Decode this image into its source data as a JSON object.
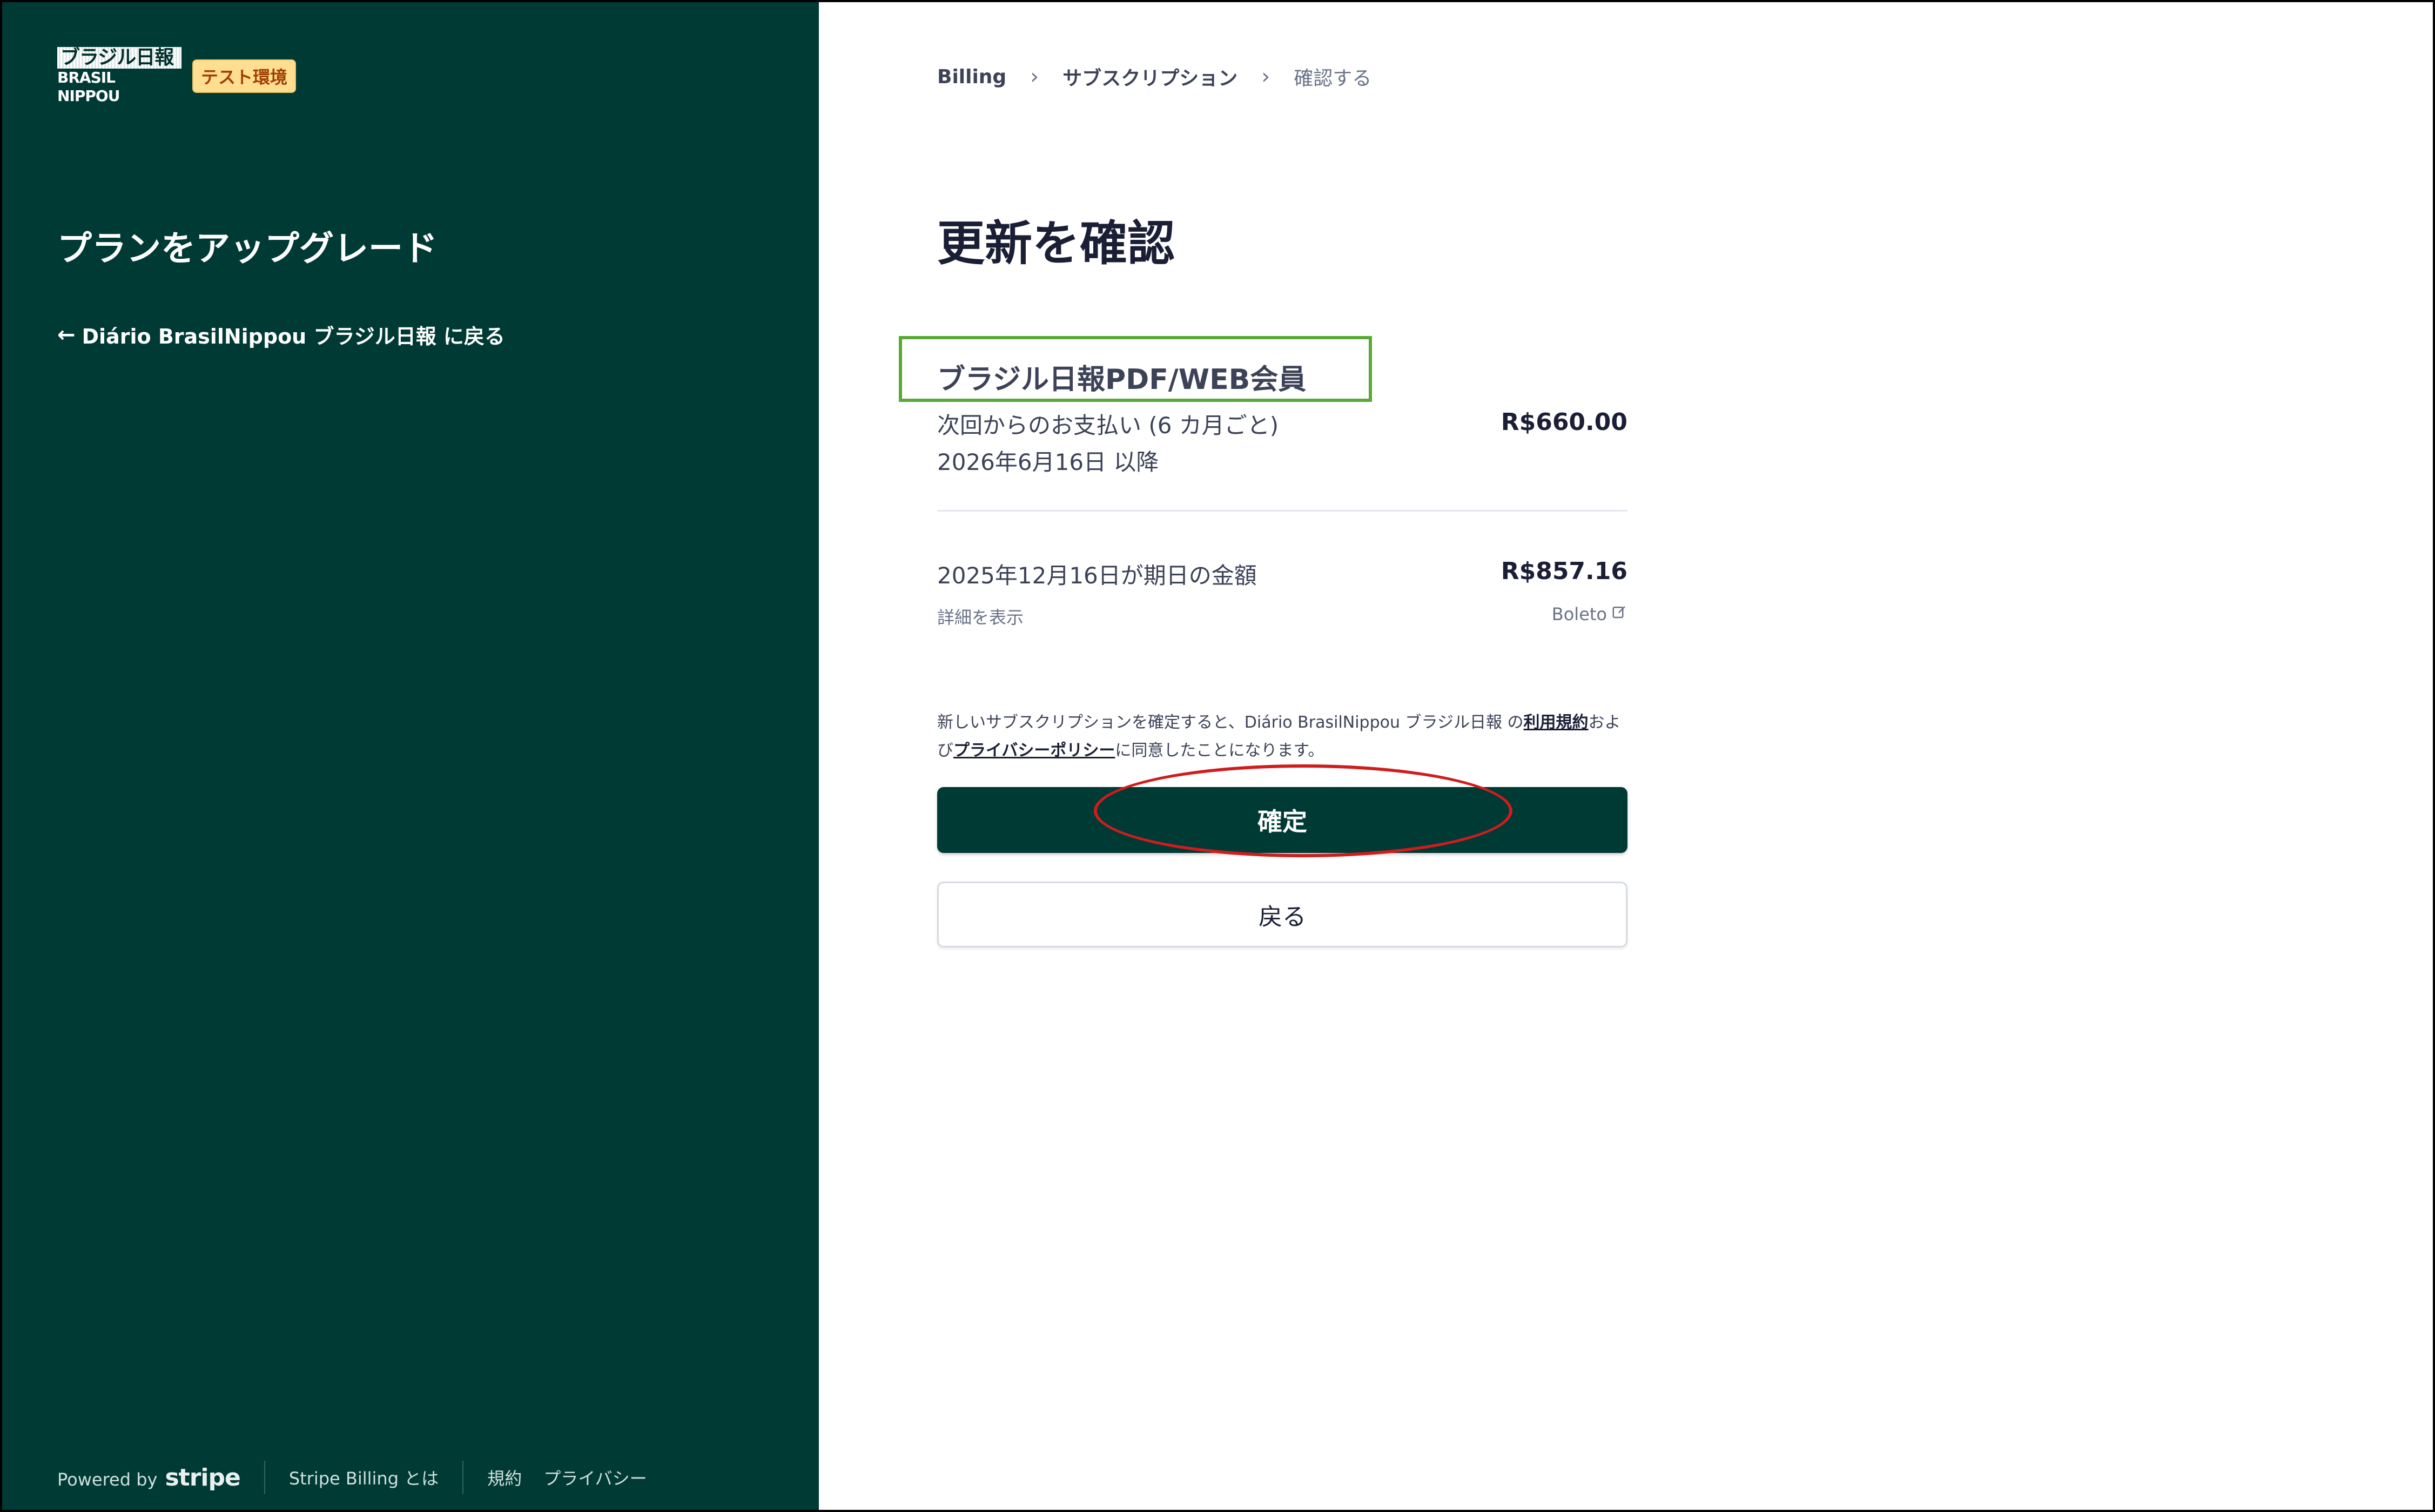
{
  "brand": {
    "logo_jp": "ブラジル日報",
    "logo_en": "BRASIL NIPPOU",
    "env_badge": "テスト環境"
  },
  "sidebar": {
    "title": "プランをアップグレード",
    "back_link": "Diário BrasilNippou ブラジル日報 に戻る"
  },
  "footer": {
    "powered_by": "Powered by",
    "stripe": "stripe",
    "stripe_billing": "Stripe Billing とは",
    "terms": "規約",
    "privacy": "プライバシー"
  },
  "breadcrumb": {
    "items": [
      "Billing",
      "サブスクリプション",
      "確認する"
    ]
  },
  "main": {
    "title": "更新を確認",
    "product_name": "ブラジル日報PDF/WEB会員",
    "next_payment_label": "次回からのお支払い (6 カ月ごと)",
    "next_payment_date": "2026年6月16日 以降",
    "next_payment_amount": "R$660.00",
    "due_label": "2025年12月16日が期日の金額",
    "due_amount": "R$857.16",
    "show_details": "詳細を表示",
    "payment_method": "Boleto",
    "terms_prefix": "新しいサブスクリプションを確定すると、Diário BrasilNippou ブラジル日報 の",
    "terms_link": "利用規約",
    "terms_and": "および",
    "privacy_link": "プライバシーポリシー",
    "terms_suffix": "に同意したことになります。",
    "confirm_button": "確定",
    "back_button": "戻る"
  },
  "colors": {
    "sidebar_bg": "#003a35",
    "highlight_box": "#5aa836",
    "annotation_ellipse": "#d01c1c"
  }
}
